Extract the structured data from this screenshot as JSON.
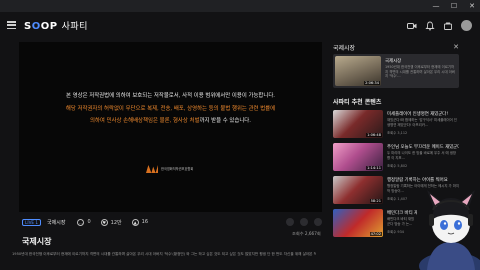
{
  "browser": {
    "minimize": "—",
    "maximize": "☐",
    "close": "✕"
  },
  "header": {
    "logo_prefix": "S",
    "logo_o": "O",
    "logo_suffix": "OP",
    "logo_sub": "사파티"
  },
  "player": {
    "notice_line1": "본 영상은 저작권법에 의하여 보호되는 저작물로서, 사적 이용 범위에서만 이용이 가능합니다.",
    "notice_line2": "해당 저작권자의 허락없이 무단으로 복제, 전송, 배포, 상영하는 등의 불법 행위는 관련 법률에",
    "notice_line3a": "의하여 민사상 손해배상책임은 물론, 형사상 처벌",
    "notice_line3b": "까지 받을 수 있습니다.",
    "org_name": "한국영화저작권보호협회"
  },
  "info": {
    "badge": "LIVE 1",
    "category": "국제시장",
    "comments": "0",
    "likes": "12만",
    "ups": "16",
    "views": "조회수 2,667회"
  },
  "video": {
    "title": "국제시장",
    "description": "1950년대 한국전쟁 이후로부터 현재에 이르기까지 격변의 시대를 관통하며 살아온 우리 시대 아버지 '덕수'(황정민) 와 그는 하고 싶은 것도 되고 싶은 것도 많았지만 평생 단 한 번도 자신을 위해 살아본 적이 없다. 영화 제작자가..."
  },
  "sidebar": {
    "title": "국제시장",
    "close": "✕",
    "playing": {
      "title": "국제시장",
      "desc": "1950년대 한국전쟁 이후로부터 현재에 이르기까지 격변의 시대를 관통하며 살아온 우리 시대 아버지 '덕수'...",
      "duration": "2:06:34"
    },
    "section_title": "사파티 추천 콘텐츠",
    "recs": [
      {
        "title": "미세플레이어 인생명연 재밌군다!",
        "desc": "재밌군다!와 함께하는 '감구석서' 미세플레이어 인생명연 재밌군다! 아프리카...",
        "meta": "조회수 3,112",
        "duration": "1:06:48"
      },
      {
        "title": "주인님 오늘도 부끄러운 메이드 재밌군다!",
        "desc": "두 마리의 나이도 한 방울 바로에 우주 서 에 생방향 이 지포...",
        "meta": "조회수 5,802",
        "duration": "1:14:11"
      },
      {
        "title": "행정알람 기록하는 아이를 찍어요",
        "desc": "행정알람 기록하는 아이에게 전하는 메시지 가 마지막 방송이...",
        "meta": "조회수 1,407",
        "duration": "58:21"
      },
      {
        "title": "배민다크 바티 재밌군다",
        "desc": "배민다크 바티 재밌군다 방송 가 는...",
        "meta": "조회수 934",
        "duration": "47:02"
      }
    ]
  },
  "colors": {
    "accent": "#4f8dff",
    "orange": "#f08a2e",
    "background": "#121214"
  }
}
